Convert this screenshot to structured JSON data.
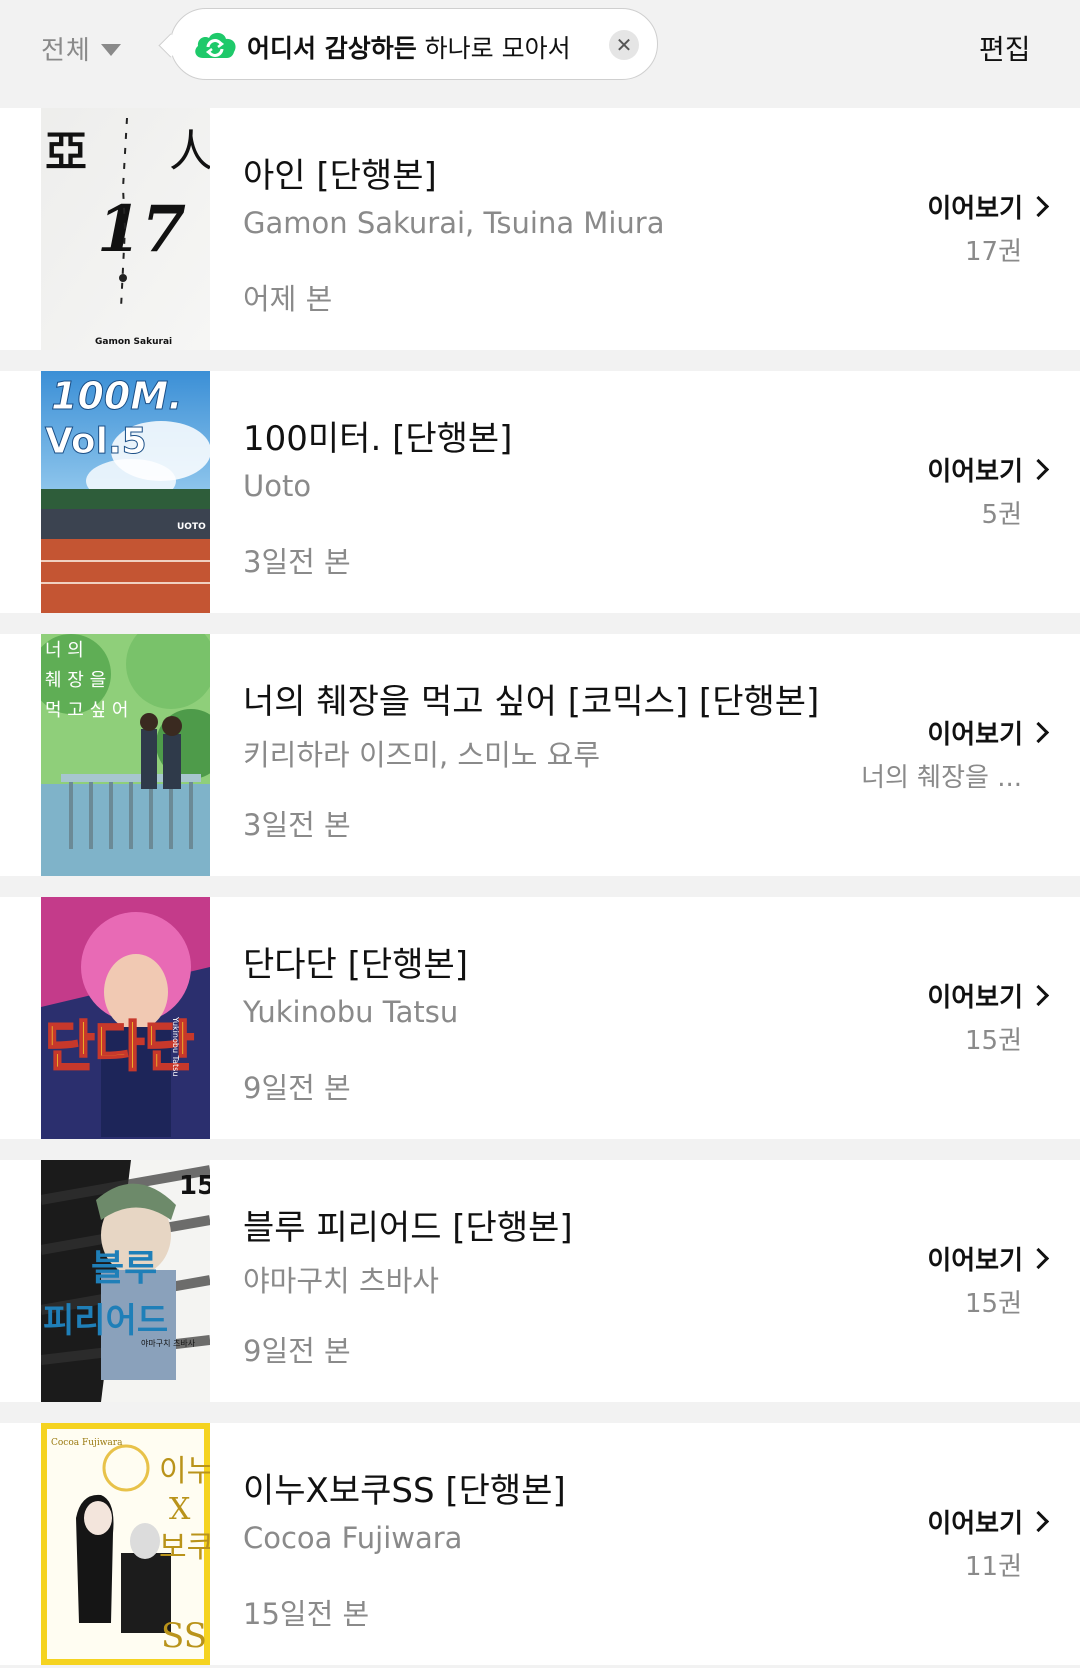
{
  "header": {
    "filter_label": "전체",
    "banner_bold": "어디서 감상하든",
    "banner_rest": " 하나로 모아서",
    "edit_label": "편집",
    "accent_color": "#1ec96a"
  },
  "items": [
    {
      "title": "아인 [단행본]",
      "author": "Gamon Sakurai, Tsuina Miura",
      "viewed": "어제 본",
      "continue_label": "이어보기",
      "volume": "17권",
      "cover_text": [
        "亞",
        "人",
        "17",
        "Gamon Sakurai"
      ]
    },
    {
      "title": "100미터. [단행본]",
      "author": "Uoto",
      "viewed": "3일전 본",
      "continue_label": "이어보기",
      "volume": "5권",
      "cover_text": [
        "100M.",
        "Vol.5",
        "UOTO"
      ]
    },
    {
      "title": "너의 췌장을 먹고 싶어 [코믹스] [단행본]",
      "author": "키리하라 이즈미, 스미노 요루",
      "viewed": "3일전 본",
      "continue_label": "이어보기",
      "volume": "너의 췌장을 ...",
      "cover_text": [
        "너 의",
        "췌 장 을",
        "먹 고  싶 어"
      ]
    },
    {
      "title": "단다단 [단행본]",
      "author": "Yukinobu Tatsu",
      "viewed": "9일전 본",
      "continue_label": "이어보기",
      "volume": "15권",
      "cover_text": [
        "단다단",
        "Yukinobu Tatsu"
      ]
    },
    {
      "title": "블루 피리어드 [단행본]",
      "author": "야마구치 츠바사",
      "viewed": "9일전 본",
      "continue_label": "이어보기",
      "volume": "15권",
      "cover_text": [
        "15",
        "블루",
        "피리어드",
        "야마구치 츠바사"
      ]
    },
    {
      "title": "이누X보쿠SS [단행본]",
      "author": "Cocoa Fujiwara",
      "viewed": "15일전 본",
      "continue_label": "이어보기",
      "volume": "11권",
      "cover_text": [
        "Cocoa Fujiwara",
        "이누",
        "X",
        "보쿠",
        "SS"
      ]
    }
  ]
}
